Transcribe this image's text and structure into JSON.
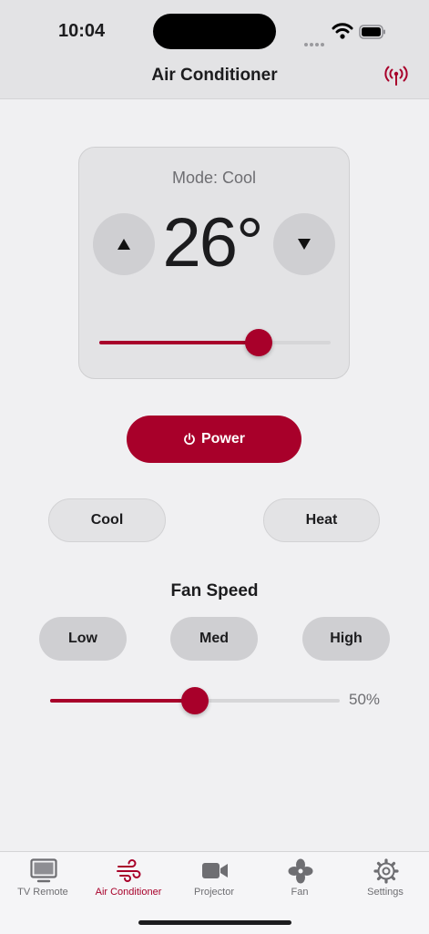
{
  "status_bar": {
    "time": "10:04"
  },
  "header": {
    "title": "Air Conditioner"
  },
  "thermostat": {
    "mode_label": "Mode: Cool",
    "temperature": "26°",
    "slider_fraction": 0.69
  },
  "power": {
    "label": "Power"
  },
  "modes": {
    "cool_label": "Cool",
    "heat_label": "Heat"
  },
  "fan": {
    "title": "Fan Speed",
    "low_label": "Low",
    "med_label": "Med",
    "high_label": "High",
    "percent_label": "50%",
    "slider_fraction": 0.5
  },
  "tabs": [
    {
      "label": "TV Remote",
      "icon": "tv-icon"
    },
    {
      "label": "Air Conditioner",
      "icon": "wind-icon"
    },
    {
      "label": "Projector",
      "icon": "video-camera-icon"
    },
    {
      "label": "Fan",
      "icon": "fan-icon"
    },
    {
      "label": "Settings",
      "icon": "gear-icon"
    }
  ],
  "colors": {
    "accent": "#a8002a",
    "background": "#f0f0f2",
    "header": "#e3e3e5"
  }
}
